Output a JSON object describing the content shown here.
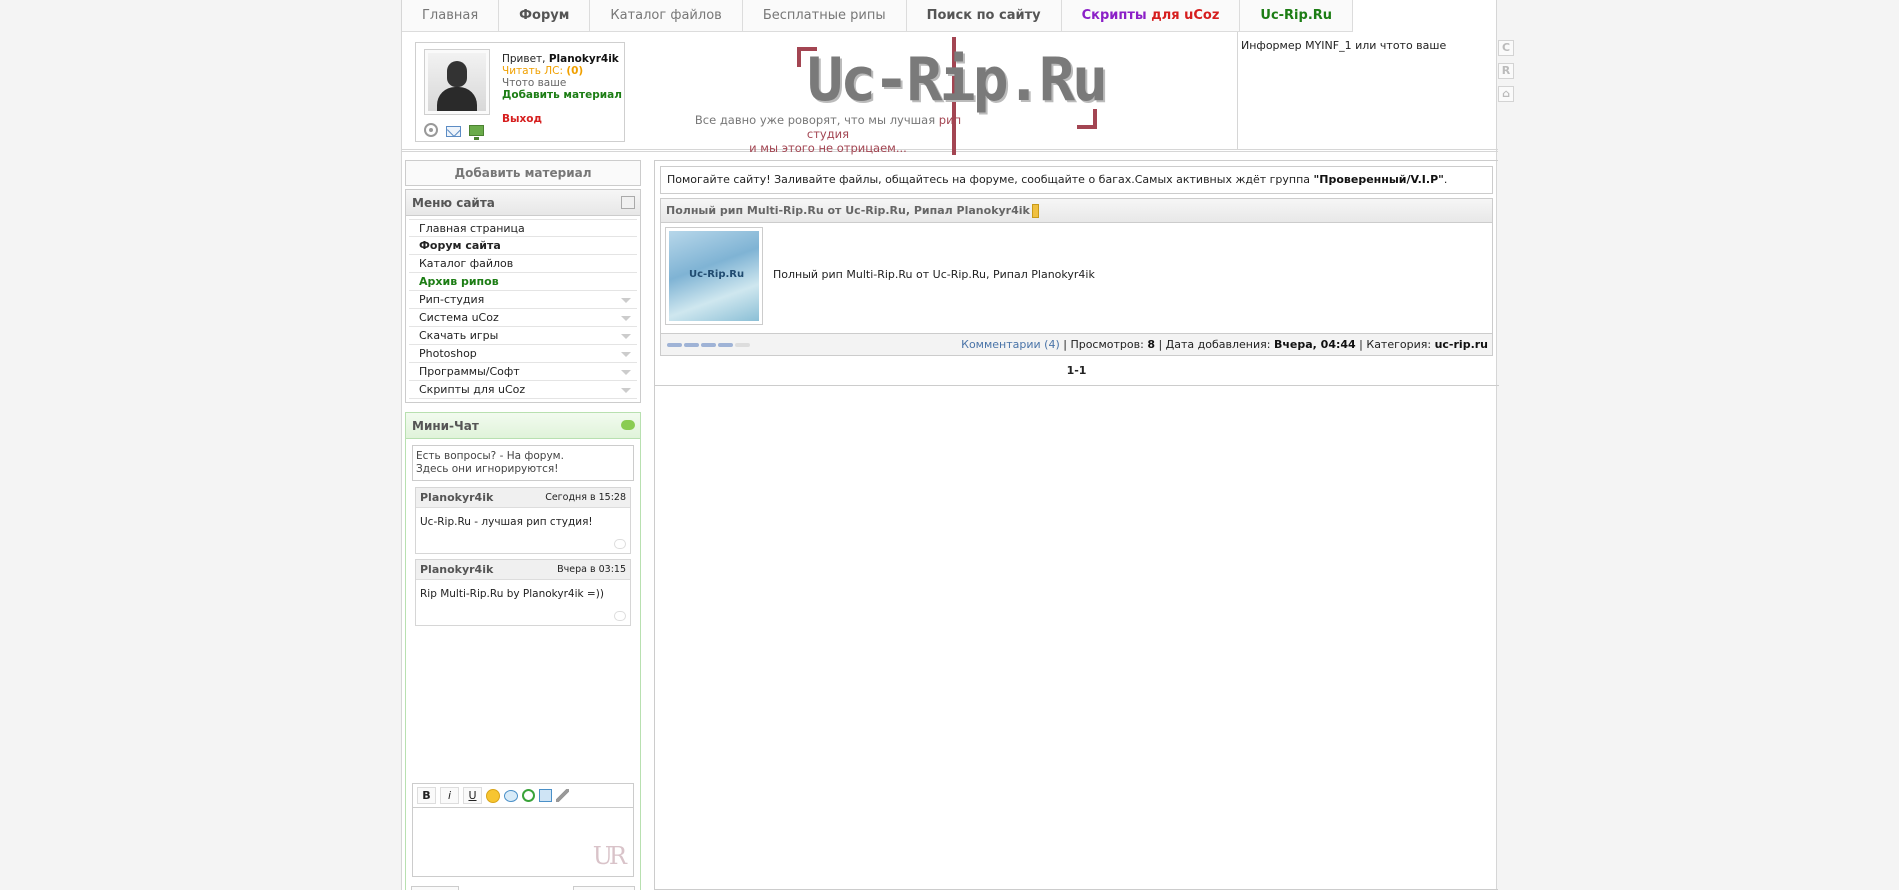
{
  "nav": {
    "items": [
      {
        "label": "Главная"
      },
      {
        "label": "Форум"
      },
      {
        "label": "Каталог файлов"
      },
      {
        "label": "Бесплатные рипы"
      },
      {
        "label": "Поиск по сайту"
      }
    ],
    "scripts_part1": "Скрипты",
    "scripts_part2": " для uCoz",
    "site_link": "Uc-Rip.Ru"
  },
  "user": {
    "greeting": "Привет, ",
    "name": "Planokyr4ik",
    "pm_label": "Читать ЛС: ",
    "pm_count": "(0)",
    "custom_text": "Чтото ваше",
    "add_material": "Добавить материал",
    "logout": "Выход"
  },
  "logo": {
    "text": "Uc-Rip.Ru",
    "slogan_part1": "Все давно уже роворят, что мы лучшая ",
    "slogan_part2": "рип студия",
    "slogan_line2": "и мы этого не отрицаем..."
  },
  "informer": "Информер MYINF_1 или чтото ваше",
  "side_buttons": [
    "C",
    "R",
    "⌂"
  ],
  "left": {
    "add_material": "Добавить материал",
    "menu_title": "Меню сайта",
    "menu_items": [
      {
        "label": "Главная страница"
      },
      {
        "label": "Форум сайта"
      },
      {
        "label": "Каталог файлов"
      },
      {
        "label": "Архив рипов"
      },
      {
        "label": "Рип-студия"
      },
      {
        "label": "Система uCoz"
      },
      {
        "label": "Скачать игры"
      },
      {
        "label": "Photoshop"
      },
      {
        "label": "Программы/Софт"
      },
      {
        "label": "Скрипты для uCoz"
      }
    ],
    "chat_title": "Мини-Чат",
    "chat_notice_line1": "Есть вопросы? - На форум.",
    "chat_notice_line2": "Здесь они игнорируются!",
    "messages": [
      {
        "author": "Planokyr4ik",
        "time": "Сегодня в 15:28",
        "text": "Uc-Rip.Ru - лучшая рип студия!"
      },
      {
        "author": "Planokyr4ik",
        "time": "Вчера в 03:15",
        "text": "Rip Multi-Rip.Ru by Planokyr4ik =))"
      }
    ],
    "toolbar": {
      "bold": "B",
      "italic": "i",
      "underline": "U"
    },
    "ur_logo": "UR"
  },
  "main": {
    "notice_text": "Помогайте сайту! Заливайте файлы, общайтесь на форуме, сообщайте о багах.Самых активных ждёт группа ",
    "notice_group": "\"Проверенный/V.I.P\"",
    "notice_end": ".",
    "entry_title": "Полный рип Multi-Rip.Ru от Uc-Rip.Ru, Рипал Planokyr4ik",
    "entry_desc": "Полный рип Multi-Rip.Ru от Uc-Rip.Ru, Рипал Planokyr4ik",
    "rating": 0.8,
    "comments_label": "Комментарии (4)",
    "views_label": " | Просмотров: ",
    "views": "8",
    "date_label": " | Дата добавления: ",
    "date": "Вчера, 04:44",
    "category_label": " | Категория: ",
    "category": "uc-rip.ru",
    "pager": "1-1"
  }
}
